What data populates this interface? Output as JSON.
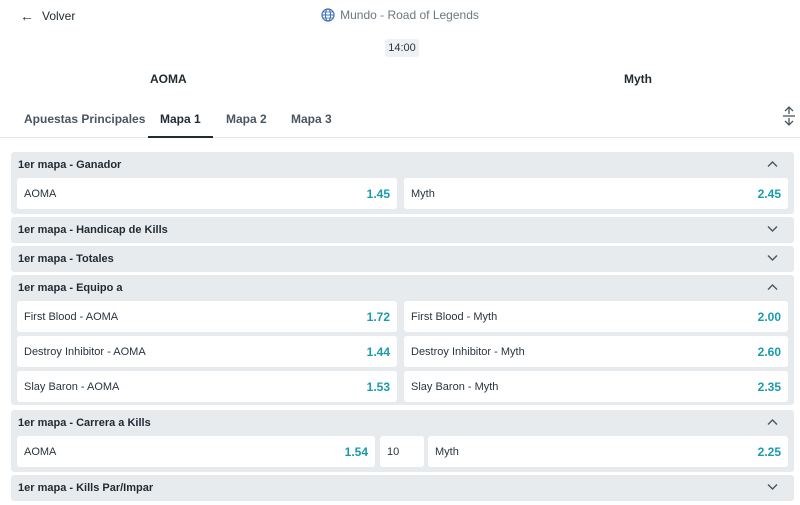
{
  "header": {
    "back_label": "Volver",
    "back_icon": "arrow-left-icon",
    "event_icon": "globe-icon",
    "event_name": "Mundo - Road of Legends",
    "time": "14:00",
    "home_team": "AOMA",
    "away_team": "Myth"
  },
  "tabs": [
    {
      "label": "Apuestas Principales",
      "active": false
    },
    {
      "label": "Mapa 1",
      "active": true
    },
    {
      "label": "Mapa 2",
      "active": false
    },
    {
      "label": "Mapa 3",
      "active": false
    }
  ],
  "markets": [
    {
      "title": "1er mapa - Ganador",
      "expanded": true,
      "selections": [
        {
          "label": "AOMA",
          "odds": "1.45"
        },
        {
          "label": "Myth",
          "odds": "2.45"
        }
      ]
    },
    {
      "title": "1er mapa - Handicap de Kills",
      "expanded": false
    },
    {
      "title": "1er mapa - Totales",
      "expanded": false
    },
    {
      "title": "1er mapa - Equipo a",
      "expanded": true,
      "rows": [
        [
          {
            "label": "First Blood - AOMA",
            "odds": "1.72"
          },
          {
            "label": "First Blood - Myth",
            "odds": "2.00"
          }
        ],
        [
          {
            "label": "Destroy Inhibitor - AOMA",
            "odds": "1.44"
          },
          {
            "label": "Destroy Inhibitor - Myth",
            "odds": "2.60"
          }
        ],
        [
          {
            "label": "Slay Baron - AOMA",
            "odds": "1.53"
          },
          {
            "label": "Slay Baron - Myth",
            "odds": "2.35"
          }
        ]
      ]
    },
    {
      "title": "1er mapa - Carrera a Kills",
      "expanded": true,
      "home": {
        "label": "AOMA",
        "odds": "1.54"
      },
      "line": "10",
      "away": {
        "label": "Myth",
        "odds": "2.25"
      }
    },
    {
      "title": "1er mapa - Kills Par/Impar",
      "expanded": false
    }
  ],
  "colors": {
    "odds": "#1a9bab",
    "market_bg": "#e7ebee",
    "active_tab": "#1f2a33"
  }
}
